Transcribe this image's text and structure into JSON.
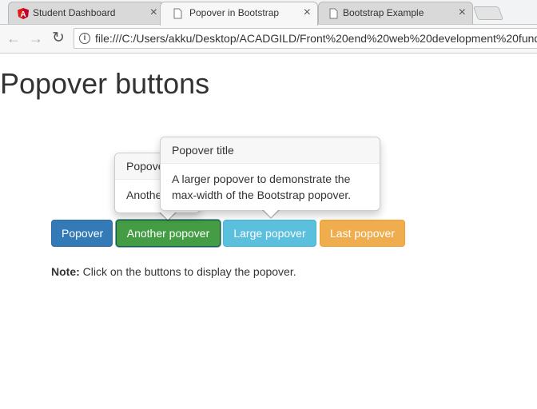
{
  "tabs": [
    {
      "title": "Student Dashboard",
      "close": "×",
      "favicon": "angular-icon"
    },
    {
      "title": "Popover in Bootstrap",
      "close": "×",
      "favicon": "page-icon"
    },
    {
      "title": "Bootstrap Example",
      "close": "×",
      "favicon": "page-icon"
    }
  ],
  "toolbar": {
    "back": "←",
    "forward": "→",
    "reload": "↻",
    "info": "i",
    "url": "file:///C:/Users/akku/Desktop/ACADGILD/Front%20end%20web%20development%20fund"
  },
  "page": {
    "title": "Popover buttons",
    "buttons": [
      "Popover",
      "Another popover",
      "Large popover",
      "Last popover"
    ],
    "note_label": "Note:",
    "note_text": " Click on the buttons to display the popover."
  },
  "popover_small": {
    "title": "Popover title",
    "content": "Another popover"
  },
  "popover_large": {
    "title": "Popover title",
    "content": "A larger popover to demonstrate the max-width of the Bootstrap popover."
  },
  "colors": {
    "primary": "#337ab7",
    "success": "#449d44",
    "info": "#5bc0de",
    "warning": "#f0ad4e",
    "angular_red": "#dd1b16"
  }
}
